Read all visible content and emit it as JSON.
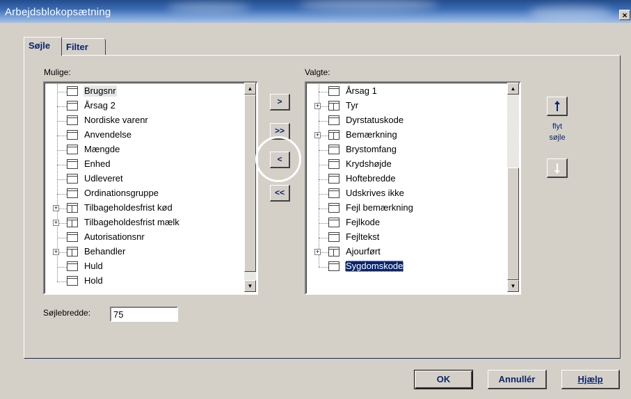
{
  "window": {
    "title": "Arbejdsblokopsætning",
    "close_label": "×"
  },
  "tabs": [
    {
      "label": "Søjle",
      "active": true
    },
    {
      "label": "Filter",
      "active": false
    }
  ],
  "available": {
    "label": "Mulige:",
    "items": [
      {
        "label": "Brugsnr",
        "expandable": false,
        "highlighted": true
      },
      {
        "label": "Årsag 2",
        "expandable": false
      },
      {
        "label": "Nordiske varenr",
        "expandable": false
      },
      {
        "label": "Anvendelse",
        "expandable": false
      },
      {
        "label": "Mængde",
        "expandable": false
      },
      {
        "label": "Enhed",
        "expandable": false
      },
      {
        "label": "Udleveret",
        "expandable": false
      },
      {
        "label": "Ordinationsgruppe",
        "expandable": false
      },
      {
        "label": "Tilbageholdesfrist kød",
        "expandable": true
      },
      {
        "label": "Tilbageholdesfrist mælk",
        "expandable": true
      },
      {
        "label": "Autorisationsnr",
        "expandable": false
      },
      {
        "label": "Behandler",
        "expandable": true
      },
      {
        "label": "Huld",
        "expandable": false
      },
      {
        "label": "Hold",
        "expandable": false
      }
    ]
  },
  "selected": {
    "label": "Valgte:",
    "items": [
      {
        "label": "Årsag 1",
        "expandable": false
      },
      {
        "label": "Tyr",
        "expandable": true
      },
      {
        "label": "Dyrstatuskode",
        "expandable": false
      },
      {
        "label": "Bemærkning",
        "expandable": true
      },
      {
        "label": "Brystomfang",
        "expandable": false
      },
      {
        "label": "Krydshøjde",
        "expandable": false
      },
      {
        "label": "Hoftebredde",
        "expandable": false
      },
      {
        "label": "Udskrives ikke",
        "expandable": false
      },
      {
        "label": "Fejl bemærkning",
        "expandable": false
      },
      {
        "label": "Fejlkode",
        "expandable": false
      },
      {
        "label": "Fejltekst",
        "expandable": false
      },
      {
        "label": "Ajourført",
        "expandable": true
      },
      {
        "label": "Sygdomskode",
        "expandable": false,
        "selected": true
      }
    ]
  },
  "transfer": {
    "add_label": ">",
    "add_all_label": ">>",
    "remove_label": "<",
    "remove_all_label": "<<"
  },
  "move": {
    "label_line1": "flyt",
    "label_line2": "søjle",
    "up_icon": "arrow-up-icon",
    "down_icon": "arrow-down-icon"
  },
  "column_width": {
    "label": "Søjlebredde:",
    "value": "75"
  },
  "footer": {
    "ok_label": "OK",
    "cancel_label": "Annullér",
    "help_label": "Hjælp"
  },
  "colors": {
    "selection": "#0a246a",
    "face": "#d4d0c8"
  }
}
